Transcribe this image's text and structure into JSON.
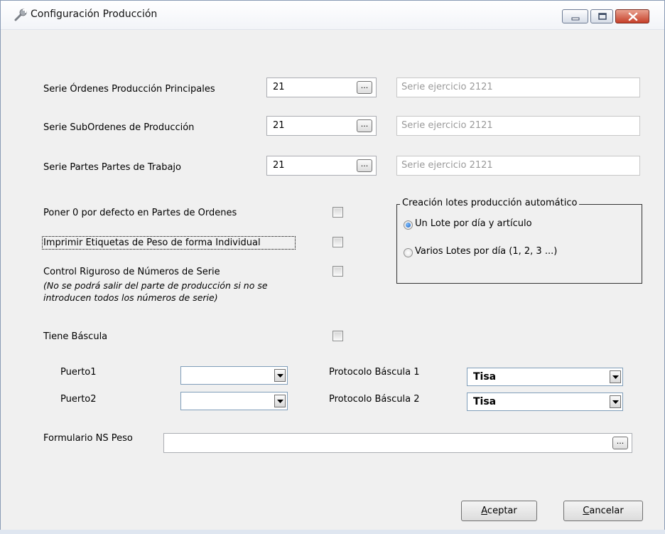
{
  "window": {
    "title": "Configuración  Producción"
  },
  "series": [
    {
      "label": "Serie Órdenes Producción Principales",
      "value": "21",
      "button": "...",
      "description": "Serie ejercicio 2121"
    },
    {
      "label": "Serie SubOrdenes de Producción",
      "value": "21",
      "button": "...",
      "description": "Serie ejercicio 2121"
    },
    {
      "label": "Serie Partes Partes de Trabajo",
      "value": "21",
      "button": "...",
      "description": "Serie ejercicio 2121"
    }
  ],
  "options": {
    "poner_cero": "Poner 0 por defecto en Partes de Ordenes",
    "imprimir_etiquetas": "Imprimir Etiquetas de Peso de forma Individual",
    "control_riguroso": "Control Riguroso de Números de Serie",
    "control_note_1": "(No se podrá salir del parte de producción si no se",
    "control_note_2": "introducen todos los números de serie)",
    "tiene_bascula": "Tiene Báscula"
  },
  "lotes_group": {
    "legend": "Creación lotes producción automático",
    "option_1": "Un Lote por día y artículo",
    "option_2": "Varios Lotes por día (1, 2, 3 ...)",
    "selected": "option_1"
  },
  "bascula": {
    "puerto1_label": "Puerto1",
    "puerto1_value": "",
    "puerto2_label": "Puerto2",
    "puerto2_value": "",
    "protocolo1_label": "Protocolo Báscula 1",
    "protocolo1_value": "Tisa",
    "protocolo2_label": "Protocolo Báscula 2",
    "protocolo2_value": "Tisa"
  },
  "formulario": {
    "label": "Formulario NS Peso",
    "value": "",
    "button": "..."
  },
  "buttons": {
    "accept": "Aceptar",
    "cancel": "Cancelar"
  },
  "icons": {
    "title": "wrench-icon",
    "minimize": "minimize-icon",
    "maximize": "maximize-icon",
    "close": "close-icon",
    "dropdown": "chevron-down-icon"
  }
}
